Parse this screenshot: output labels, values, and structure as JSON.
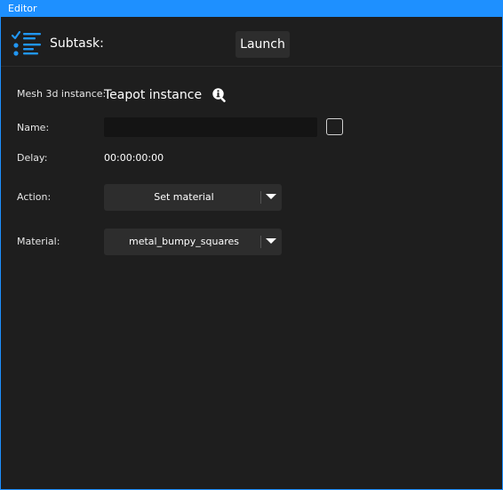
{
  "window": {
    "title": "Editor"
  },
  "header": {
    "subtask_label": "Subtask:",
    "subtask_icon": "task-list-icon",
    "launch_label": "Launch"
  },
  "form": {
    "mesh": {
      "label": "Mesh 3d instance:",
      "value": "Teapot instance",
      "info_icon": "info-magnifier-icon"
    },
    "name": {
      "label": "Name:",
      "value": "",
      "placeholder": "",
      "checked": false
    },
    "delay": {
      "label": "Delay:",
      "value": "00:00:00:00"
    },
    "action": {
      "label": "Action:",
      "selected": "Set material"
    },
    "material": {
      "label": "Material:",
      "selected": "metal_bumpy_squares"
    }
  },
  "colors": {
    "accent": "#1e90ff",
    "background": "#1e1e1e",
    "control": "#2d2d2d",
    "input": "#141414",
    "text": "#ffffff"
  }
}
